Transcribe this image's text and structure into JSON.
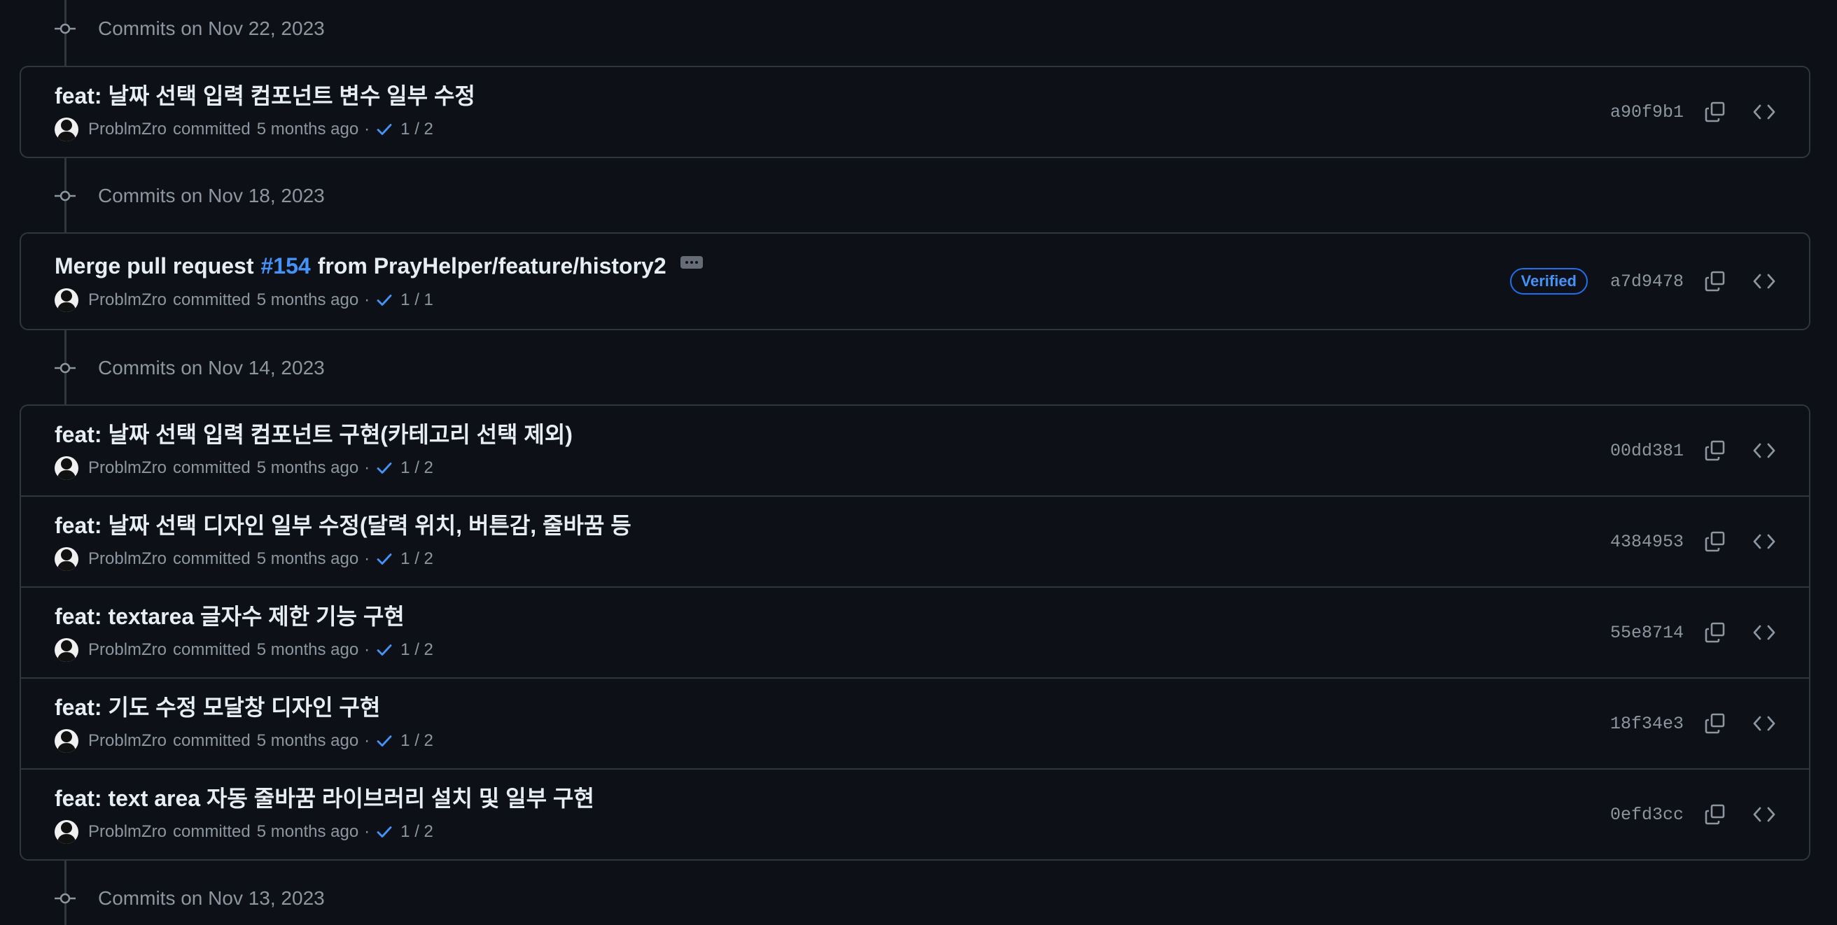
{
  "colors": {
    "background": "#0d1117",
    "border": "#30363d",
    "text_primary": "#e6edf3",
    "text_muted": "#8d96a0",
    "link": "#4493f8",
    "check": "#4493f8"
  },
  "groups": [
    {
      "title": "Commits on Nov 22, 2023",
      "commits": [
        {
          "title": "feat: 날짜 선택 입력 컴포넌트 변수 일부 수정",
          "author": "ProblmZro",
          "committed": "committed",
          "time": "5 months ago",
          "separator": "·",
          "checks": "1 / 2",
          "sha": "a90f9b1",
          "icons": [
            "copy-icon",
            "code-icon"
          ]
        }
      ]
    },
    {
      "title": "Commits on Nov 18, 2023",
      "commits": [
        {
          "title_prefix": "Merge pull request",
          "pr_link": "#154",
          "title_suffix": "from PrayHelper/feature/history2",
          "has_ellipsis": true,
          "verified": "Verified",
          "author": "ProblmZro",
          "committed": "committed",
          "time": "5 months ago",
          "separator": "·",
          "checks": "1 / 1",
          "sha": "a7d9478",
          "icons": [
            "copy-icon",
            "code-icon"
          ]
        }
      ]
    },
    {
      "title": "Commits on Nov 14, 2023",
      "commits": [
        {
          "title": "feat: 날짜 선택 입력 컴포넌트 구현(카테고리 선택 제외)",
          "author": "ProblmZro",
          "committed": "committed",
          "time": "5 months ago",
          "separator": "·",
          "checks": "1 / 2",
          "sha": "00dd381",
          "icons": [
            "copy-icon",
            "code-icon"
          ]
        },
        {
          "title": "feat: 날짜 선택 디자인 일부 수정(달력 위치, 버튼감, 줄바꿈 등",
          "author": "ProblmZro",
          "committed": "committed",
          "time": "5 months ago",
          "separator": "·",
          "checks": "1 / 2",
          "sha": "4384953",
          "icons": [
            "copy-icon",
            "code-icon"
          ]
        },
        {
          "title": "feat: textarea 글자수 제한 기능 구현",
          "author": "ProblmZro",
          "committed": "committed",
          "time": "5 months ago",
          "separator": "·",
          "checks": "1 / 2",
          "sha": "55e8714",
          "icons": [
            "copy-icon",
            "code-icon"
          ]
        },
        {
          "title": "feat: 기도 수정 모달창 디자인 구현",
          "author": "ProblmZro",
          "committed": "committed",
          "time": "5 months ago",
          "separator": "·",
          "checks": "1 / 2",
          "sha": "18f34e3",
          "icons": [
            "copy-icon",
            "code-icon"
          ]
        },
        {
          "title": "feat: text area 자동 줄바꿈 라이브러리 설치 및 일부 구현",
          "author": "ProblmZro",
          "committed": "committed",
          "time": "5 months ago",
          "separator": "·",
          "checks": "1 / 2",
          "sha": "0efd3cc",
          "icons": [
            "copy-icon",
            "code-icon"
          ]
        }
      ]
    },
    {
      "title": "Commits on Nov 13, 2023",
      "commits": []
    }
  ]
}
